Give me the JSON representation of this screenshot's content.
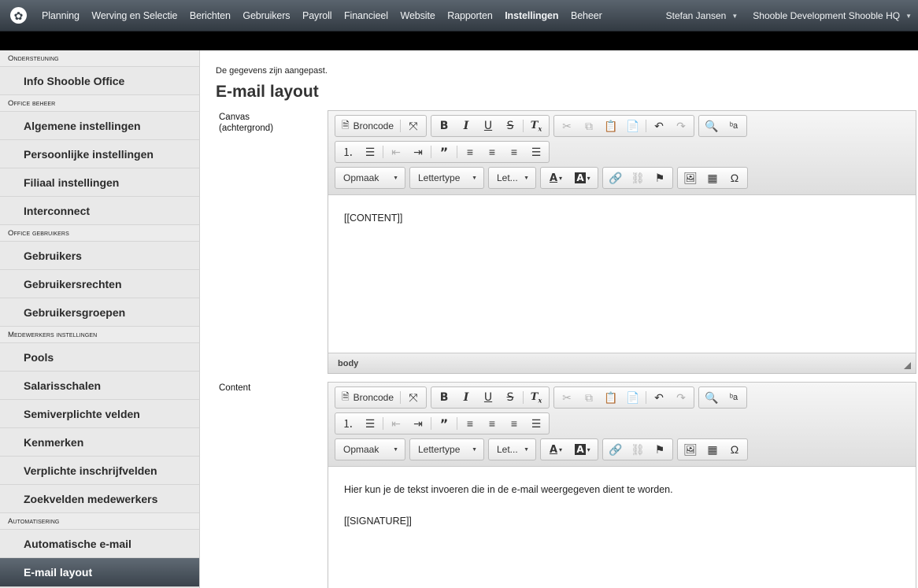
{
  "topbar": {
    "nav": [
      {
        "label": "Planning",
        "active": false
      },
      {
        "label": "Werving en Selectie",
        "active": false
      },
      {
        "label": "Berichten",
        "active": false
      },
      {
        "label": "Gebruikers",
        "active": false
      },
      {
        "label": "Payroll",
        "active": false
      },
      {
        "label": "Financieel",
        "active": false
      },
      {
        "label": "Website",
        "active": false
      },
      {
        "label": "Rapporten",
        "active": false
      },
      {
        "label": "Instellingen",
        "active": true
      },
      {
        "label": "Beheer",
        "active": false
      }
    ],
    "user": "Stefan Jansen",
    "organization": "Shooble Development Shooble HQ"
  },
  "sidebar": {
    "sections": [
      {
        "title": "Ondersteuning",
        "items": [
          "Info Shooble Office"
        ]
      },
      {
        "title": "Office beheer",
        "items": [
          "Algemene instellingen",
          "Persoonlijke instellingen",
          "Filiaal instellingen",
          "Interconnect"
        ]
      },
      {
        "title": "Office gebruikers",
        "items": [
          "Gebruikers",
          "Gebruikersrechten",
          "Gebruikersgroepen"
        ]
      },
      {
        "title": "Medewerkers instellingen",
        "items": [
          "Pools",
          "Salarisschalen",
          "Semiverplichte velden",
          "Kenmerken",
          "Verplichte inschrijfvelden",
          "Zoekvelden medewerkers"
        ]
      },
      {
        "title": "Automatisering",
        "items": [
          "Automatische e-mail",
          "E-mail layout"
        ]
      }
    ],
    "active_item": "E-mail layout"
  },
  "main": {
    "notice": "De gegevens zijn aangepast.",
    "title": "E-mail layout",
    "canvas_label": "Canvas\n(achtergrond)",
    "content_label": "Content",
    "canvas_content": [
      "[[CONTENT]]"
    ],
    "content_content": [
      "Hier kun je de tekst invoeren die in de e-mail weergegeven dient te worden.",
      "[[SIGNATURE]]"
    ],
    "statusbar_path": "body"
  },
  "toolbar": {
    "source_label": "Broncode",
    "format_label": "Opmaak",
    "font_label": "Lettertype",
    "size_label": "Let...",
    "icons": [
      "document-source-icon",
      "maximize-icon",
      "bold-icon",
      "italic-icon",
      "underline-icon",
      "strikethrough-icon",
      "remove-format-icon",
      "cut-icon",
      "copy-icon",
      "paste-icon",
      "paste-text-icon",
      "undo-icon",
      "redo-icon",
      "find-icon",
      "replace-icon",
      "numbered-list-icon",
      "bulleted-list-icon",
      "outdent-icon",
      "indent-icon",
      "blockquote-icon",
      "align-left-icon",
      "align-center-icon",
      "align-right-icon",
      "justify-icon",
      "text-color-icon",
      "background-color-icon",
      "link-icon",
      "unlink-icon",
      "anchor-icon",
      "image-icon",
      "table-icon",
      "special-char-icon"
    ]
  }
}
